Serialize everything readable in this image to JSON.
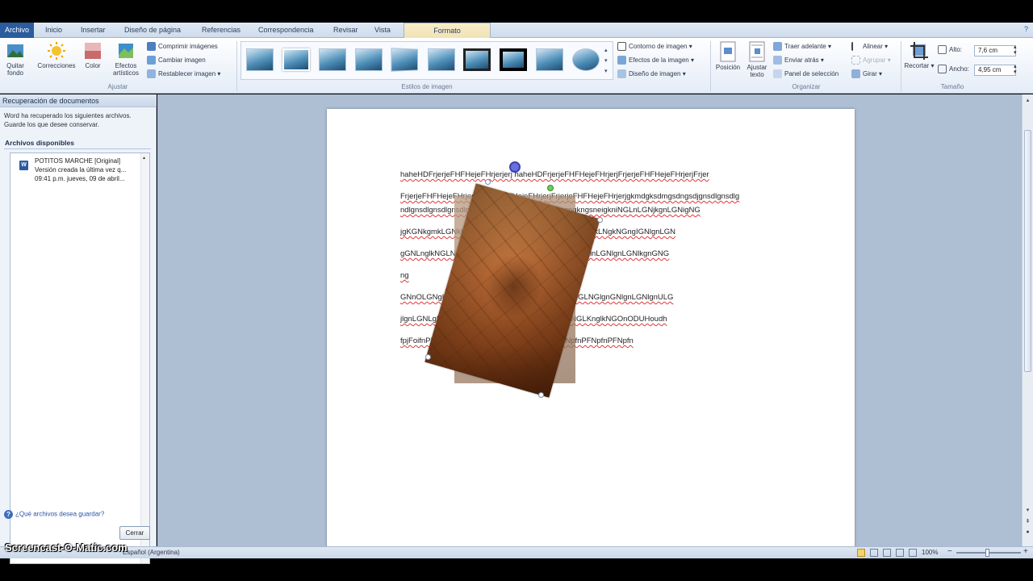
{
  "ribbon_tabs": [
    {
      "label": "Archivo"
    },
    {
      "label": "Inicio"
    },
    {
      "label": "Insertar"
    },
    {
      "label": "Diseño de página"
    },
    {
      "label": "Referencias"
    },
    {
      "label": "Correspondencia"
    },
    {
      "label": "Revisar"
    },
    {
      "label": "Vista"
    },
    {
      "label": "Formato"
    }
  ],
  "ribbon": {
    "adjust": {
      "remove_bg": "Quitar fondo",
      "corrections": "Correcciones",
      "color": "Color",
      "artistic": "Efectos artísticos",
      "compress": "Comprimir imágenes",
      "change": "Cambiar imagen",
      "reset": "Restablecer imagen",
      "group_label": "Ajustar"
    },
    "styles": {
      "group_label": "Estilos de imagen",
      "border": "Contorno de imagen",
      "effects": "Efectos de la imagen",
      "layout": "Diseño de imagen"
    },
    "arrange": {
      "position": "Posición",
      "wrap": "Ajustar texto",
      "bring_forward": "Traer adelante",
      "send_backward": "Enviar atrás",
      "selection_pane": "Panel de selección",
      "align": "Alinear",
      "group": "Agrupar",
      "rotate": "Girar",
      "group_label": "Organizar"
    },
    "size": {
      "crop": "Recortar",
      "height_label": "Alto:",
      "height_value": "7,6 cm",
      "width_label": "Ancho:",
      "width_value": "4,95 cm",
      "group_label": "Tamaño"
    }
  },
  "recovery_pane": {
    "title": "Recuperación de documentos",
    "message_line1": "Word ha recuperado los siguientes archivos.",
    "message_line2": "Guarde los que desee conservar.",
    "files_header": "Archivos disponibles",
    "file": {
      "icon_letter": "W",
      "name": "POTITOS MARCHE  [Original]",
      "line2": "Versión creada la última vez q...",
      "line3": "09:41 p.m. jueves, 09 de abril..."
    },
    "help_link": "¿Qué archivos desea guardar?",
    "close_button": "Cerrar"
  },
  "document": {
    "lines": [
      "haheHDFrjerjeFHFHejeFHrjerjerj haheHDFrjerjeFHFHejeFHrjerjFrjerjeFHFHejeFHrjerjFrjer",
      "FrjerjeFHFHejeFHrjerjFrjerjeFHFHejeFHrjerjFrjerjeFHFHejeFHrjerjgkmdgksdmgsdngsdjgnsdlgnsdlg",
      "ndlgnsdlgnsdlgnsdlgnsdlgnlgkngsdgnsdgnsdgknsngkngsneigkniNGLnLGNjkgnLGNigNG",
      "jgKGNkgmkLGNkLNGkLNGLkNGLkNGLkNGLkNGkLNGkLNgkNGngIGNlgnLGN",
      "gGNLnglkNGLNGLNGLkNGLNGLNGLNGLNGLNGLNglnLGNlgnLGNlkgnGNG",
      "ng",
      "GNnOLGNgLNGLNGLNGLNGLNGLNGLNGLNGLNGLNGlgnGNlgnLGNlgnULG",
      "jlgnLGNLgLNGLNGLNGLNGLNGLNGLNGLNGLkNGLKnglkNGOnODUHoudh",
      "fpjFoifnPFNpfnPFNpfnPFNpfnPFNpfnPFNpfnPFNpfnPFNpfnPFNpfn"
    ]
  },
  "status_bar": {
    "language": "Español (Argentina)",
    "zoom": "100%"
  },
  "watermark": "Screencast-O-Matic.com"
}
